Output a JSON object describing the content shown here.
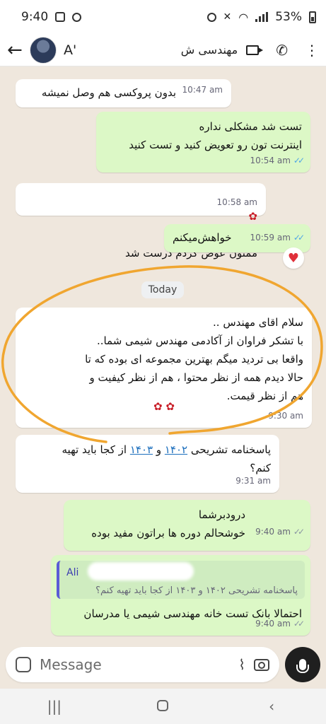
{
  "status_bar": {
    "time": "9:40",
    "battery": "53%"
  },
  "header": {
    "back_icon": "arrow-left-icon",
    "contact_name": "A'",
    "contact_name_rtl": "مهندسی ش",
    "icons": [
      "video-call-icon",
      "phone-icon",
      "more-vert-icon"
    ]
  },
  "messages": [
    {
      "dir": "in",
      "text": "بدون پروکسی هم وصل نمیشه",
      "time": "10:47 am"
    },
    {
      "dir": "out",
      "text": "تست شد مشکلی نداره\nاینترنت تون رو تعویض کنید و تست کنید",
      "time": "10:54 am"
    },
    {
      "dir": "in",
      "text": "ممنون عوض کردم درست شد",
      "time": "10:58 am"
    },
    {
      "dir": "out",
      "text": "خواهش‌میکنم",
      "time": "10:59 am"
    },
    {
      "dir": "in",
      "text": "سلام اقای مهندس ..\nبا تشکر فراوان از آکادمی مهندس شیمی شما..\nواقعا بی تردید میگم بهترین مجموعه ای بوده که تا\nحالا دیدم همه از نظر محتوا ، هم از نظر کیفیت و\nهم از نظر قیمت.",
      "time": "9:30 am"
    },
    {
      "dir": "in",
      "text_pre": "پاسخنامه تشریحی ",
      "link1": "۱۴۰۲",
      "text_mid": " و ",
      "link2": "۱۴۰۳",
      "text_post": " از کجا باید تهیه\nکنم؟",
      "time": "9:31 am"
    },
    {
      "dir": "out",
      "text": "درودبرشما\nخوشحالم دوره ها براتون مفید بوده",
      "time": "9:40 am"
    },
    {
      "dir": "out",
      "quote_name": "Ali",
      "quote_text": "پاسخنامه تشریحی ۱۴۰۲ و ۱۴۰۳ از کجا باید تهیه کنم؟",
      "text": "احتمالا بانک تست خانه مهندسی شیمی یا مدرسان",
      "time": "9:40 am"
    }
  ],
  "day_separator": "Today",
  "reaction": "heart",
  "input": {
    "placeholder": "Message"
  },
  "colors": {
    "incoming": "#ffffff",
    "outgoing": "#dcf8c6",
    "annotation": "#f0a630",
    "read_ticks": "#4fa6e6"
  }
}
